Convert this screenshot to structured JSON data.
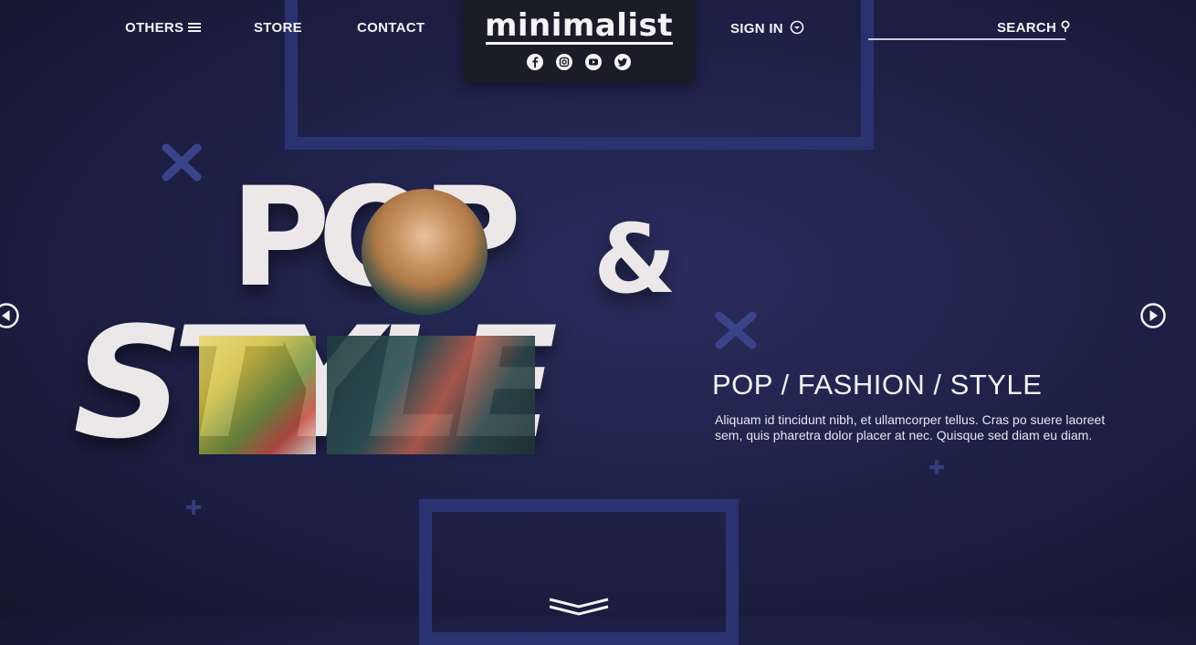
{
  "nav": {
    "others_label": "OTHERS",
    "store_label": "STORE",
    "contact_label": "CONTACT",
    "signin_label": "SIGN IN",
    "search_label": "SEARCH"
  },
  "brand": {
    "title": "minimalist",
    "social_icons": [
      "facebook-icon",
      "instagram-icon",
      "youtube-icon",
      "twitter-icon"
    ]
  },
  "hero": {
    "word_top": "POP",
    "ampersand": "&",
    "word_bottom": "STYLE",
    "tagline": "POP / FASHION / STYLE",
    "description": "Aliquam id tincidunt nibh, et ullamcorper tellus. Cras po suere laoreet sem, quis pharetra dolor placer at nec. Quisque sed diam eu diam."
  },
  "colors": {
    "background": "#1f2249",
    "frame": "#2b3270",
    "brand_box": "#1b1c27",
    "text": "#ffffff"
  }
}
